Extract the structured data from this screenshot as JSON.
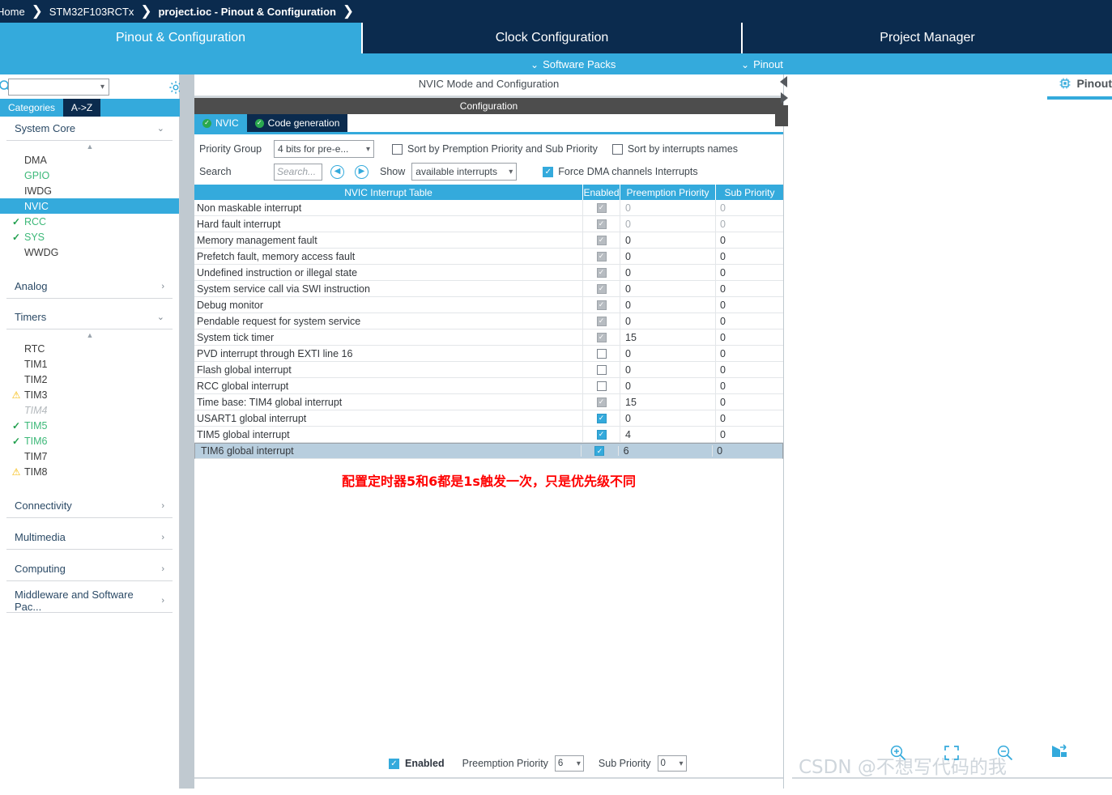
{
  "breadcrumb": {
    "items": [
      {
        "label": "Home",
        "bold": false
      },
      {
        "label": "STM32F103RCTx",
        "bold": false
      },
      {
        "label": "project.ioc - Pinout & Configuration",
        "bold": true
      }
    ]
  },
  "tabs": [
    {
      "label": "Pinout & Configuration",
      "active": true
    },
    {
      "label": "Clock Configuration",
      "active": false
    },
    {
      "label": "Project Manager",
      "active": false
    }
  ],
  "substrip": {
    "software_packs": "Software Packs",
    "pinout": "Pinout",
    "chevron": "⌄"
  },
  "sidebar": {
    "search_value": "",
    "search_placeholder": "",
    "gear_icon": "gear-icon",
    "magnifier_icon": "search-icon",
    "tabs": [
      {
        "label": "Categories",
        "active": true
      },
      {
        "label": "A->Z",
        "active": false
      }
    ],
    "groups": [
      {
        "title": "System Core",
        "expanded": true,
        "arrow": "⌄",
        "items": [
          {
            "label": "DMA",
            "state": "none"
          },
          {
            "label": "GPIO",
            "state": "green"
          },
          {
            "label": "IWDG",
            "state": "none"
          },
          {
            "label": "NVIC",
            "state": "selected"
          },
          {
            "label": "RCC",
            "state": "check"
          },
          {
            "label": "SYS",
            "state": "check"
          },
          {
            "label": "WWDG",
            "state": "none"
          }
        ]
      },
      {
        "title": "Analog",
        "expanded": false,
        "arrow": "›",
        "items": []
      },
      {
        "title": "Timers",
        "expanded": true,
        "arrow": "⌄",
        "items": [
          {
            "label": "RTC",
            "state": "none"
          },
          {
            "label": "TIM1",
            "state": "none"
          },
          {
            "label": "TIM2",
            "state": "none"
          },
          {
            "label": "TIM3",
            "state": "warn"
          },
          {
            "label": "TIM4",
            "state": "disabled"
          },
          {
            "label": "TIM5",
            "state": "check"
          },
          {
            "label": "TIM6",
            "state": "check"
          },
          {
            "label": "TIM7",
            "state": "none"
          },
          {
            "label": "TIM8",
            "state": "warn"
          }
        ]
      },
      {
        "title": "Connectivity",
        "expanded": false,
        "arrow": "›",
        "items": []
      },
      {
        "title": "Multimedia",
        "expanded": false,
        "arrow": "›",
        "items": []
      },
      {
        "title": "Computing",
        "expanded": false,
        "arrow": "›",
        "items": []
      },
      {
        "title": "Middleware and Software Pac...",
        "expanded": false,
        "arrow": "›",
        "items": []
      }
    ]
  },
  "main": {
    "panel_title": "NVIC Mode and Configuration",
    "configuration_label": "Configuration",
    "inner_tabs": [
      {
        "label": "NVIC",
        "active": true
      },
      {
        "label": "Code generation",
        "active": false
      }
    ],
    "priority_group_label": "Priority Group",
    "priority_group_value": "4 bits for pre-e...",
    "sort_premption_label": "Sort by Premption Priority and Sub Priority",
    "sort_premption_checked": false,
    "sort_names_label": "Sort by interrupts names",
    "sort_names_checked": false,
    "search_label": "Search",
    "search_value": "",
    "search_placeholder": "Search...",
    "prev_icon": "chevron-left-circle-icon",
    "next_icon": "chevron-right-circle-icon",
    "show_label": "Show",
    "show_value": "available interrupts",
    "force_dma_label": "Force DMA channels Interrupts",
    "force_dma_checked": true,
    "table": {
      "headers": [
        "NVIC Interrupt Table",
        "Enabled",
        "Preemption Priority",
        "Sub Priority"
      ],
      "rows": [
        {
          "name": "Non maskable interrupt",
          "enabled": "disabled-checked",
          "preemption": "0",
          "sub": "0",
          "dim": true,
          "selected": false
        },
        {
          "name": "Hard fault interrupt",
          "enabled": "disabled-checked",
          "preemption": "0",
          "sub": "0",
          "dim": true,
          "selected": false
        },
        {
          "name": "Memory management fault",
          "enabled": "disabled-checked",
          "preemption": "0",
          "sub": "0",
          "dim": false,
          "selected": false
        },
        {
          "name": "Prefetch fault, memory access fault",
          "enabled": "disabled-checked",
          "preemption": "0",
          "sub": "0",
          "dim": false,
          "selected": false
        },
        {
          "name": "Undefined instruction or illegal state",
          "enabled": "disabled-checked",
          "preemption": "0",
          "sub": "0",
          "dim": false,
          "selected": false
        },
        {
          "name": "System service call via SWI instruction",
          "enabled": "disabled-checked",
          "preemption": "0",
          "sub": "0",
          "dim": false,
          "selected": false
        },
        {
          "name": "Debug monitor",
          "enabled": "disabled-checked",
          "preemption": "0",
          "sub": "0",
          "dim": false,
          "selected": false
        },
        {
          "name": "Pendable request for system service",
          "enabled": "disabled-checked",
          "preemption": "0",
          "sub": "0",
          "dim": false,
          "selected": false
        },
        {
          "name": "System tick timer",
          "enabled": "disabled-checked",
          "preemption": "15",
          "sub": "0",
          "dim": false,
          "selected": false
        },
        {
          "name": "PVD interrupt through EXTI line 16",
          "enabled": "unchecked",
          "preemption": "0",
          "sub": "0",
          "dim": false,
          "selected": false
        },
        {
          "name": "Flash global interrupt",
          "enabled": "unchecked",
          "preemption": "0",
          "sub": "0",
          "dim": false,
          "selected": false
        },
        {
          "name": "RCC global interrupt",
          "enabled": "unchecked",
          "preemption": "0",
          "sub": "0",
          "dim": false,
          "selected": false
        },
        {
          "name": "Time base: TIM4 global interrupt",
          "enabled": "disabled-checked",
          "preemption": "15",
          "sub": "0",
          "dim": false,
          "selected": false
        },
        {
          "name": "USART1 global interrupt",
          "enabled": "checked",
          "preemption": "0",
          "sub": "0",
          "dim": false,
          "selected": false
        },
        {
          "name": "TIM5 global interrupt",
          "enabled": "checked",
          "preemption": "4",
          "sub": "0",
          "dim": false,
          "selected": false
        },
        {
          "name": "TIM6 global interrupt",
          "enabled": "checked",
          "preemption": "6",
          "sub": "0",
          "dim": false,
          "selected": true
        }
      ]
    },
    "annotation": "配置定时器5和6都是1s触发一次，只是优先级不同",
    "bottom": {
      "enabled_label": "Enabled",
      "enabled_checked": true,
      "preemption_label": "Preemption Priority",
      "preemption_value": "6",
      "sub_label": "Sub Priority",
      "sub_value": "0"
    }
  },
  "right": {
    "pinout_button_label": "Pinout",
    "chip_icon": "chip-icon",
    "tools": [
      {
        "name": "zoom-in-icon"
      },
      {
        "name": "fit-to-screen-icon"
      },
      {
        "name": "zoom-out-icon"
      },
      {
        "name": "rotate-icon"
      }
    ],
    "watermark": "CSDN @不想写代码的我"
  },
  "colors": {
    "accent_blue": "#34aadc",
    "dark_navy": "#0b2b4e",
    "gray_bar": "#4d4d4d",
    "selection_row": "#b8cede",
    "green": "#3cb878",
    "warn_yellow": "#f5b800",
    "annotation_red": "#ff0000"
  }
}
